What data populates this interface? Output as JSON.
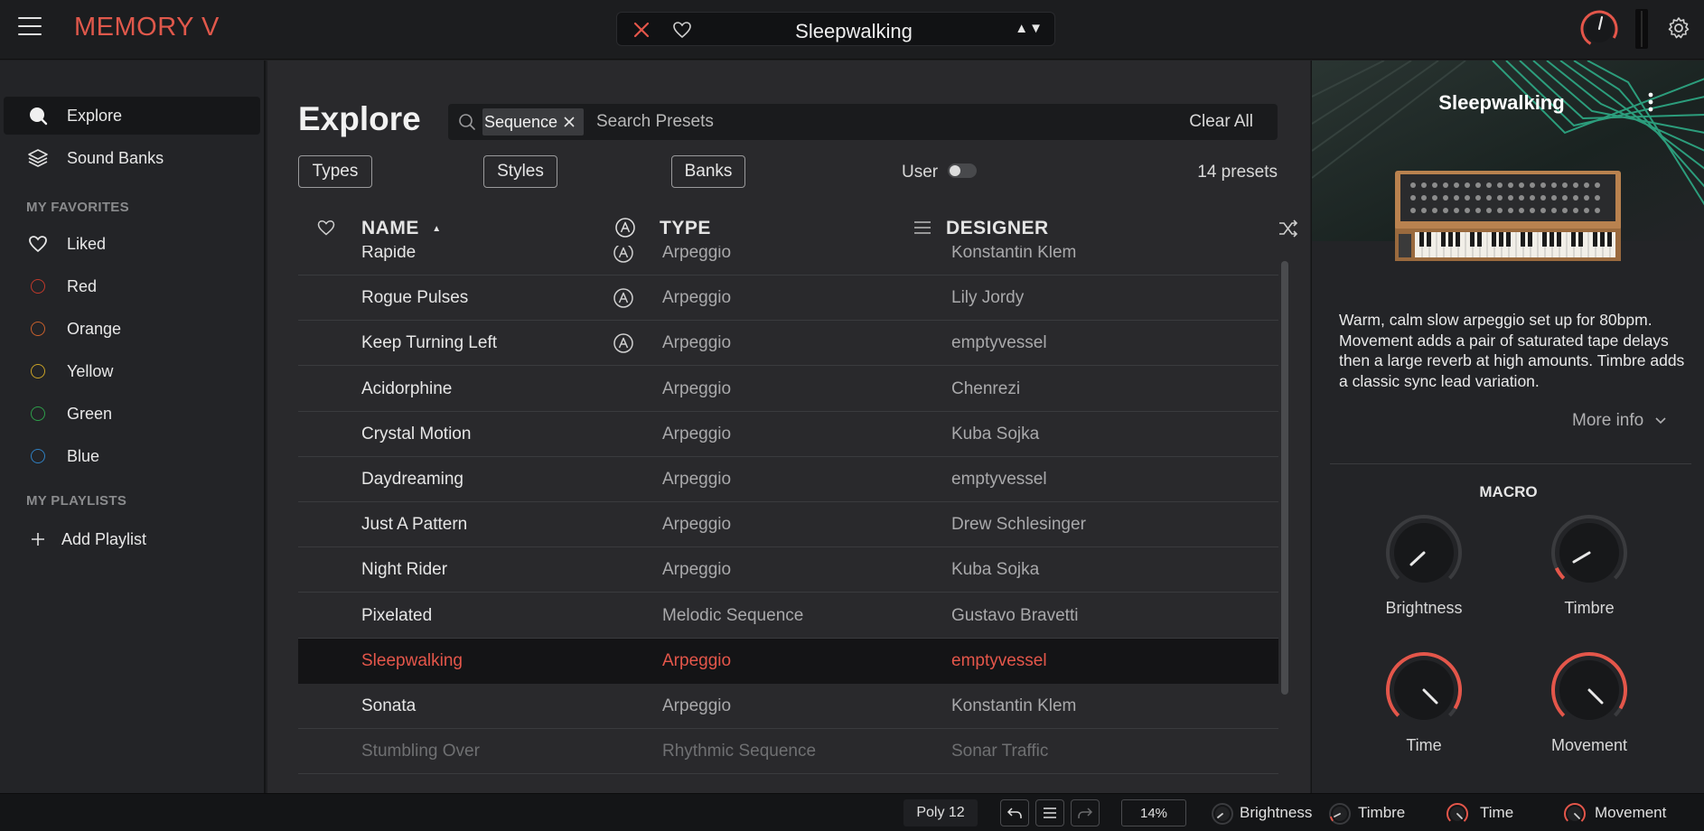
{
  "app": {
    "title": "MEMORY V"
  },
  "preset_bar": {
    "name": "Sleepwalking",
    "nav_arrows": "▲▼"
  },
  "sidebar": {
    "items": [
      {
        "label": "Explore"
      },
      {
        "label": "Sound Banks"
      }
    ],
    "favorites_heading": "MY FAVORITES",
    "favorites": [
      {
        "label": "Liked"
      },
      {
        "label": "Red",
        "color": "#c0392b"
      },
      {
        "label": "Orange",
        "color": "#c8602c"
      },
      {
        "label": "Yellow",
        "color": "#c9a227"
      },
      {
        "label": "Green",
        "color": "#2e9e4a"
      },
      {
        "label": "Blue",
        "color": "#2f7fc1"
      }
    ],
    "playlists_heading": "MY PLAYLISTS",
    "add_playlist": "Add Playlist"
  },
  "main": {
    "title": "Explore",
    "search": {
      "tag": "Sequence",
      "placeholder": "Search Presets",
      "clear_label": "Clear All"
    },
    "filters": {
      "types": "Types",
      "styles": "Styles",
      "banks": "Banks",
      "user": "User"
    },
    "preset_count": "14 presets",
    "columns": {
      "name": "NAME",
      "sort_arrow": "▲",
      "type": "TYPE",
      "designer": "DESIGNER"
    },
    "rows": [
      {
        "name": "Rapide",
        "type": "Arpeggio",
        "designer": "Konstantin Klem",
        "arturia": true
      },
      {
        "name": "Rogue Pulses",
        "type": "Arpeggio",
        "designer": "Lily Jordy",
        "arturia": true
      },
      {
        "name": "Keep Turning Left",
        "type": "Arpeggio",
        "designer": "emptyvessel",
        "arturia": true
      },
      {
        "name": "Acidorphine",
        "type": "Arpeggio",
        "designer": "Chenrezi",
        "arturia": false
      },
      {
        "name": "Crystal Motion",
        "type": "Arpeggio",
        "designer": "Kuba Sojka",
        "arturia": false
      },
      {
        "name": "Daydreaming",
        "type": "Arpeggio",
        "designer": "emptyvessel",
        "arturia": false
      },
      {
        "name": "Just A Pattern",
        "type": "Arpeggio",
        "designer": "Drew Schlesinger",
        "arturia": false
      },
      {
        "name": "Night Rider",
        "type": "Arpeggio",
        "designer": "Kuba Sojka",
        "arturia": false
      },
      {
        "name": "Pixelated",
        "type": "Melodic Sequence",
        "designer": "Gustavo Bravetti",
        "arturia": false
      },
      {
        "name": "Sleepwalking",
        "type": "Arpeggio",
        "designer": "emptyvessel",
        "arturia": false,
        "selected": true
      },
      {
        "name": "Sonata",
        "type": "Arpeggio",
        "designer": "Konstantin Klem",
        "arturia": false
      },
      {
        "name": "Stumbling Over",
        "type": "Rhythmic Sequence",
        "designer": "Sonar Traffic",
        "arturia": false,
        "faded": true
      }
    ]
  },
  "right_panel": {
    "preset_name": "Sleepwalking",
    "description": "Warm, calm slow arpeggio set up for 80bpm. Movement adds a pair of saturated tape delays then a large reverb at high amounts. Timbre adds a classic sync lead variation.",
    "more_info": "More info",
    "macro_title": "MACRO",
    "macros": [
      {
        "label": "Brightness"
      },
      {
        "label": "Timbre"
      },
      {
        "label": "Time"
      },
      {
        "label": "Movement"
      }
    ]
  },
  "bottom_bar": {
    "poly": "Poly 12",
    "cpu": "14%",
    "macro_labels": [
      "Brightness",
      "Timbre",
      "Time",
      "Movement"
    ]
  },
  "colors": {
    "accent": "#e4564a",
    "background": "#29292c",
    "sidebar": "#232427"
  }
}
